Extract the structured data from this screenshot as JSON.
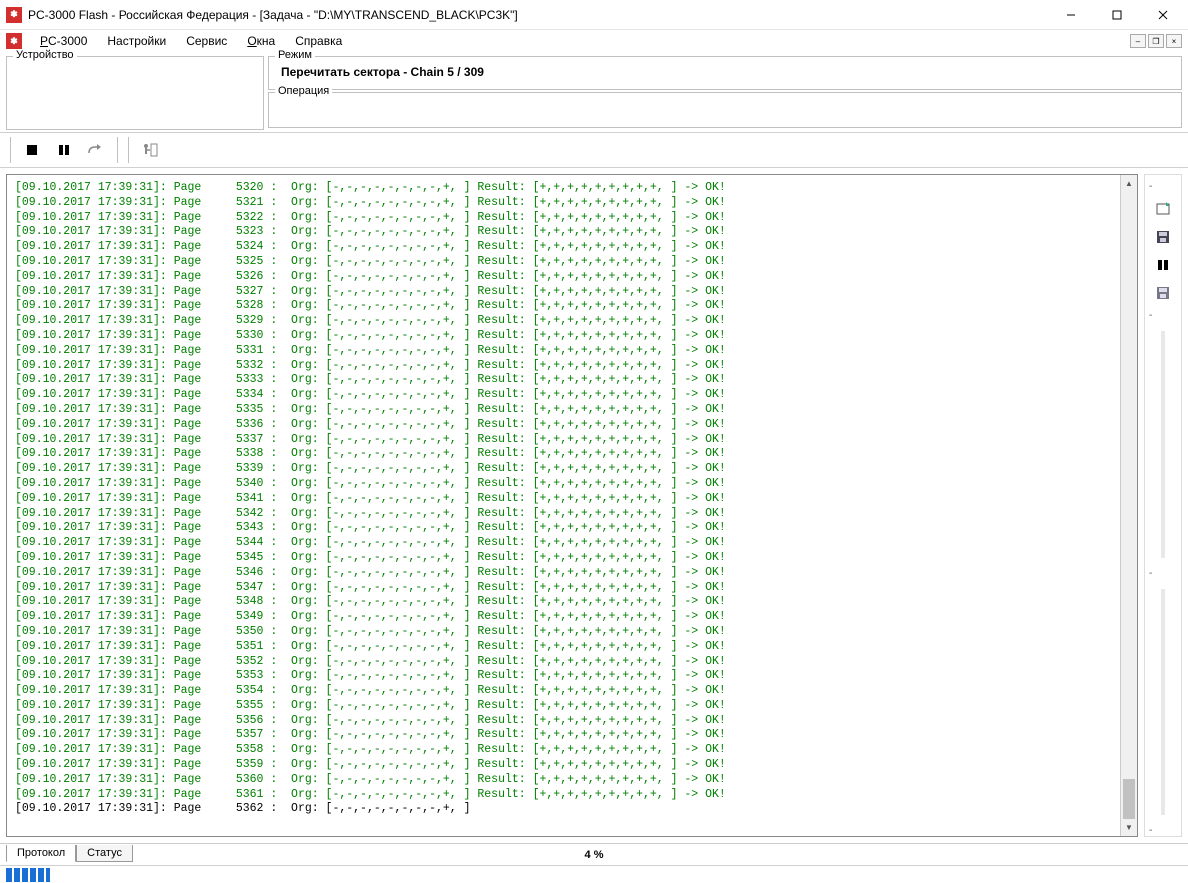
{
  "title": "PC-3000 Flash  - Российская Федерация - [Задача - \"D:\\MY\\TRANSCEND_BLACK\\PC3K\"]",
  "menu": {
    "items": [
      "PC-3000",
      "Настройки",
      "Сервис",
      "Окна",
      "Справка"
    ]
  },
  "panels": {
    "device_label": "Устройство",
    "mode_label": "Режим",
    "mode_text": "Перечитать сектора - Chain 5 / 309",
    "operation_label": "Операция"
  },
  "tabs": {
    "protocol": "Протокол",
    "status": "Статус"
  },
  "status": {
    "percent": "4 %"
  },
  "log": {
    "prefix": "[09.10.2017 17:39:31]: Page",
    "page_start": 5320,
    "page_end": 5362,
    "org": "Org: [-,-,-,-,-,-,-,-,+, ]",
    "result": "Result: [+,+,+,+,+,+,+,+,+, ] -> OK!"
  }
}
